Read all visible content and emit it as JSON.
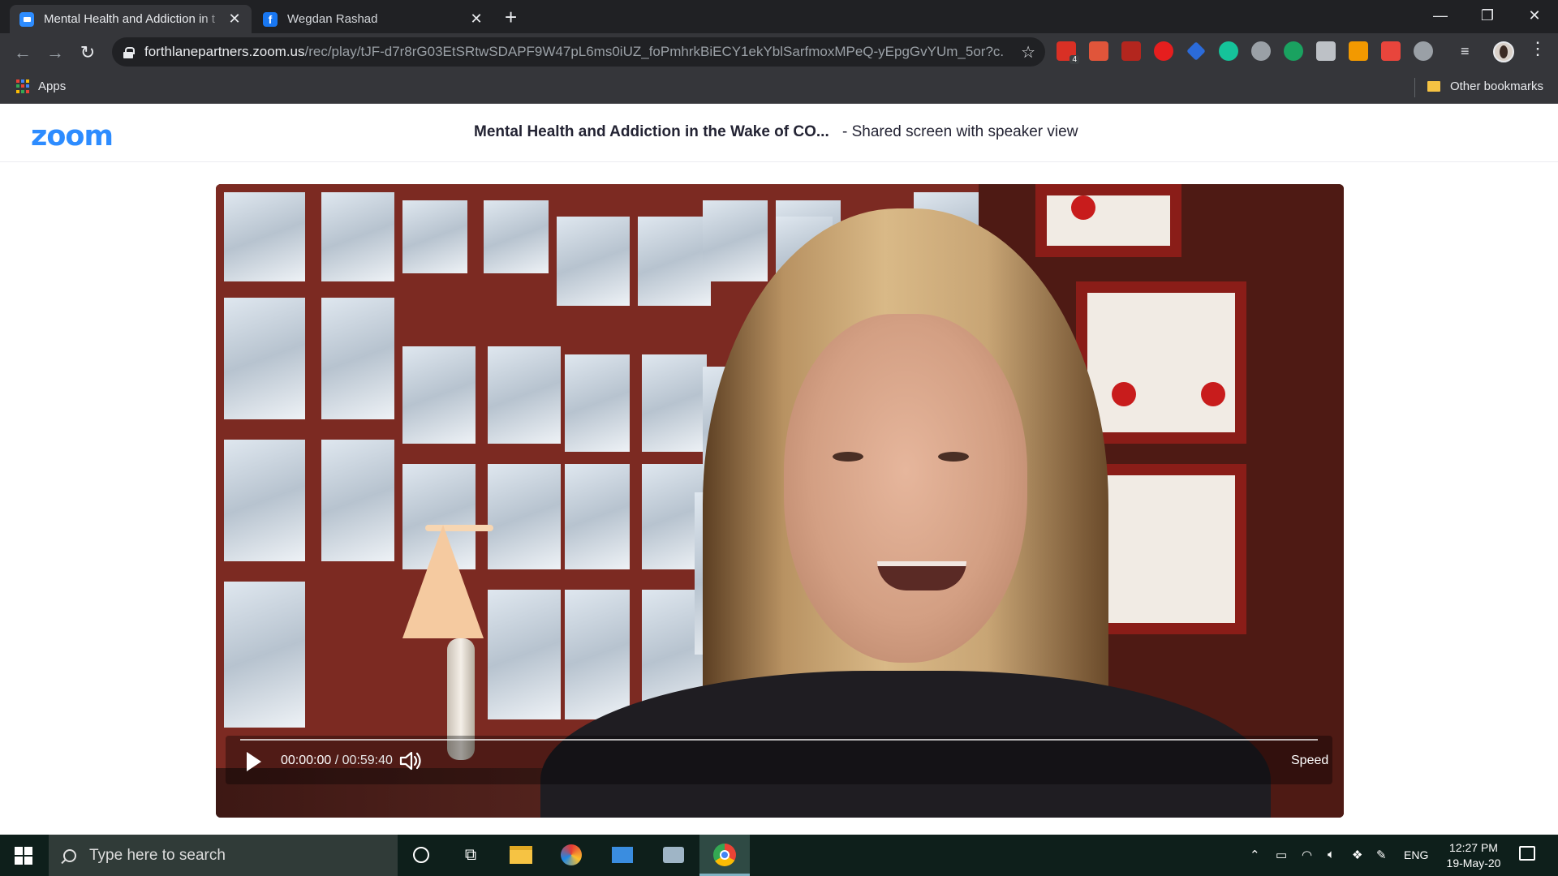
{
  "browser": {
    "tabs": [
      {
        "title": "Mental Health and Addiction in t",
        "favicon": "zoom-icon",
        "active": true
      },
      {
        "title": "Wegdan Rashad",
        "favicon": "facebook-icon",
        "active": false
      }
    ],
    "url_host": "forthlanepartners.zoom.us",
    "url_path": "/rec/play/tJF-d7r8rG03EtSRtwSDAPF9W47pL6ms0iUZ_foPmhrkBiECY1ekYblSarfmoxMPeQ-yEpgGvYUm_5or?c...",
    "extension_badge": "4",
    "bookmarks": {
      "apps": "Apps",
      "other": "Other bookmarks"
    }
  },
  "zoom": {
    "logo": "zoom",
    "meeting_title": "Mental Health and Addiction in the Wake of CO...",
    "meeting_subtitle": "- Shared screen with speaker view"
  },
  "player": {
    "current_time": "00:00:00",
    "separator": "/",
    "total_time": "00:59:40",
    "speed_label": "Speed",
    "progress": 0
  },
  "taskbar": {
    "search_placeholder": "Type here to search",
    "language": "ENG",
    "time": "12:27 PM",
    "date": "19-May-20"
  },
  "colors": {
    "zoom_blue": "#2d8cff",
    "chrome_dark": "#202124",
    "taskbar": "#0e1f1b"
  }
}
